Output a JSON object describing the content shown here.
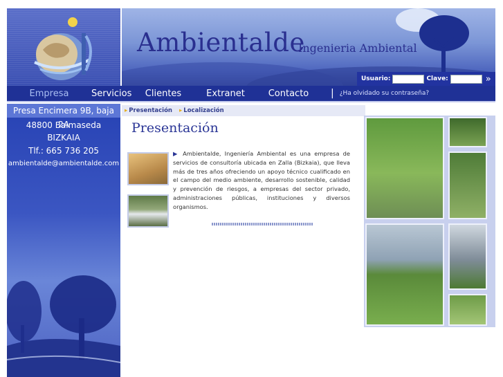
{
  "header": {
    "brand_name": "Ambientalde",
    "brand_tagline": "Ingenieria Ambiental",
    "login": {
      "user_label": "Usuario:",
      "password_label": "Clave:"
    }
  },
  "nav": {
    "items": [
      "Empresa",
      "Servicios",
      "Clientes",
      "Extranet",
      "Contacto"
    ],
    "forgot_password": "¿Ha olvidado su contraseña?"
  },
  "sidebar": {
    "address_line1": "Presa Encimera 9B, baja 2A",
    "address_line2": "48800 Balmaseda",
    "address_line3": "BIZKAIA",
    "phone": "Tlf.: 665 736 205",
    "email": "ambientalde@ambientalde.com"
  },
  "breadcrumb": [
    "Presentación",
    "Localización"
  ],
  "content": {
    "title": "Presentación",
    "body": "Ambientalde, Ingeniería Ambiental es una empresa de servicios de consultoría ubicada en Zalla (Bizkaia), que lleva más de tres años ofreciendo un apoyo técnico cualificado en el campo del medio ambiente, desarrollo sostenible, calidad y prevención de riesgos, a empresas del sector privado, administraciones públicas, instituciones y diversos organismos."
  },
  "colors": {
    "nav_bg": "#1f3196",
    "brand_text": "#2a2f8f",
    "accent_arrow": "#e6b020"
  }
}
